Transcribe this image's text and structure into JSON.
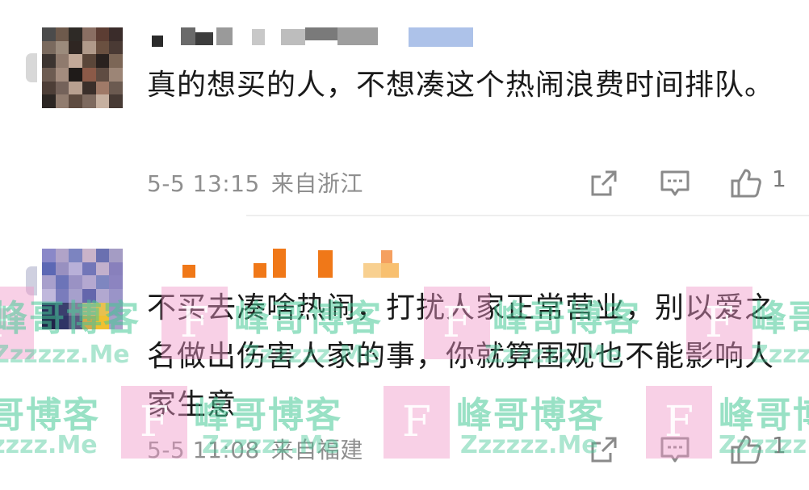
{
  "comments": [
    {
      "text": "真的想买的人，不想凑这个热闹浪费时间排队。",
      "time": "5-5 13:15",
      "location": "来自浙江",
      "likes": "1",
      "avatar_colors": [
        "#4b4b4b",
        "#6e5a4c",
        "#2e2a26",
        "#8a6f63",
        "#5c3d33",
        "#3a2c2a",
        "#7a6a5e",
        "#9b8b7c",
        "#2f2622",
        "#b09a8a",
        "#6a5040",
        "#4a3a34",
        "#3c3430",
        "#8f7a6d",
        "#c2a998",
        "#5a4639",
        "#2a221f",
        "#7c6656",
        "#6d5c52",
        "#a38c7e",
        "#1f1b19",
        "#8b5a48",
        "#5f4c42",
        "#9c8576",
        "#4d3e37",
        "#74625a",
        "#b8a090",
        "#3b2f2a",
        "#a07a68",
        "#6b5a50",
        "#2c2623",
        "#917c6f",
        "#5e4b40",
        "#7e6a5f",
        "#c6b0a0",
        "#473a34"
      ],
      "username_colors": [
        "#2b2b2b",
        "#9a9a9a",
        "#d0d0d0",
        "#8aa8e0"
      ]
    },
    {
      "text": "不买去凑啥热闹，打扰人家正常营业，别以爱之名做出伤害人家的事，你就算围观也不能影响人家生意",
      "time": "5-5 11:08",
      "location": "来自福建",
      "likes": "1",
      "avatar_colors": [
        "#8a88c8",
        "#b0a3c8",
        "#7c84c0",
        "#c9b3c9",
        "#6a70b0",
        "#a49cc4",
        "#5c68b4",
        "#9890c0",
        "#b8b0d8",
        "#7276b8",
        "#c2b0cc",
        "#8880bc",
        "#a8a0cc",
        "#6c74b8",
        "#9a92c4",
        "#b4a8d0",
        "#7e86c0",
        "#8c84c0",
        "#c0b8dc",
        "#7a7cbc",
        "#a6a0cc",
        "#6466ac",
        "#b2a8d0",
        "#9a94c8",
        "#2a2e5a",
        "#3b3f6e",
        "#84809c",
        "#c8b884",
        "#e8c050",
        "#9c94c0",
        "#20244a",
        "#303466",
        "#5a5a80",
        "#d4a84c",
        "#f0c030",
        "#a8a0c8"
      ],
      "username_colors": [
        "#f07818",
        "#f5a060",
        "#f8d090"
      ]
    }
  ],
  "watermark": {
    "letter": "F",
    "name": "峰哥博客",
    "url": "Zzzzzz.Me",
    "box_color": "#f096c8",
    "text_color": "#46c896"
  },
  "icons": {
    "share": "share-icon",
    "comment": "comment-icon",
    "like": "thumbs-up-icon"
  }
}
